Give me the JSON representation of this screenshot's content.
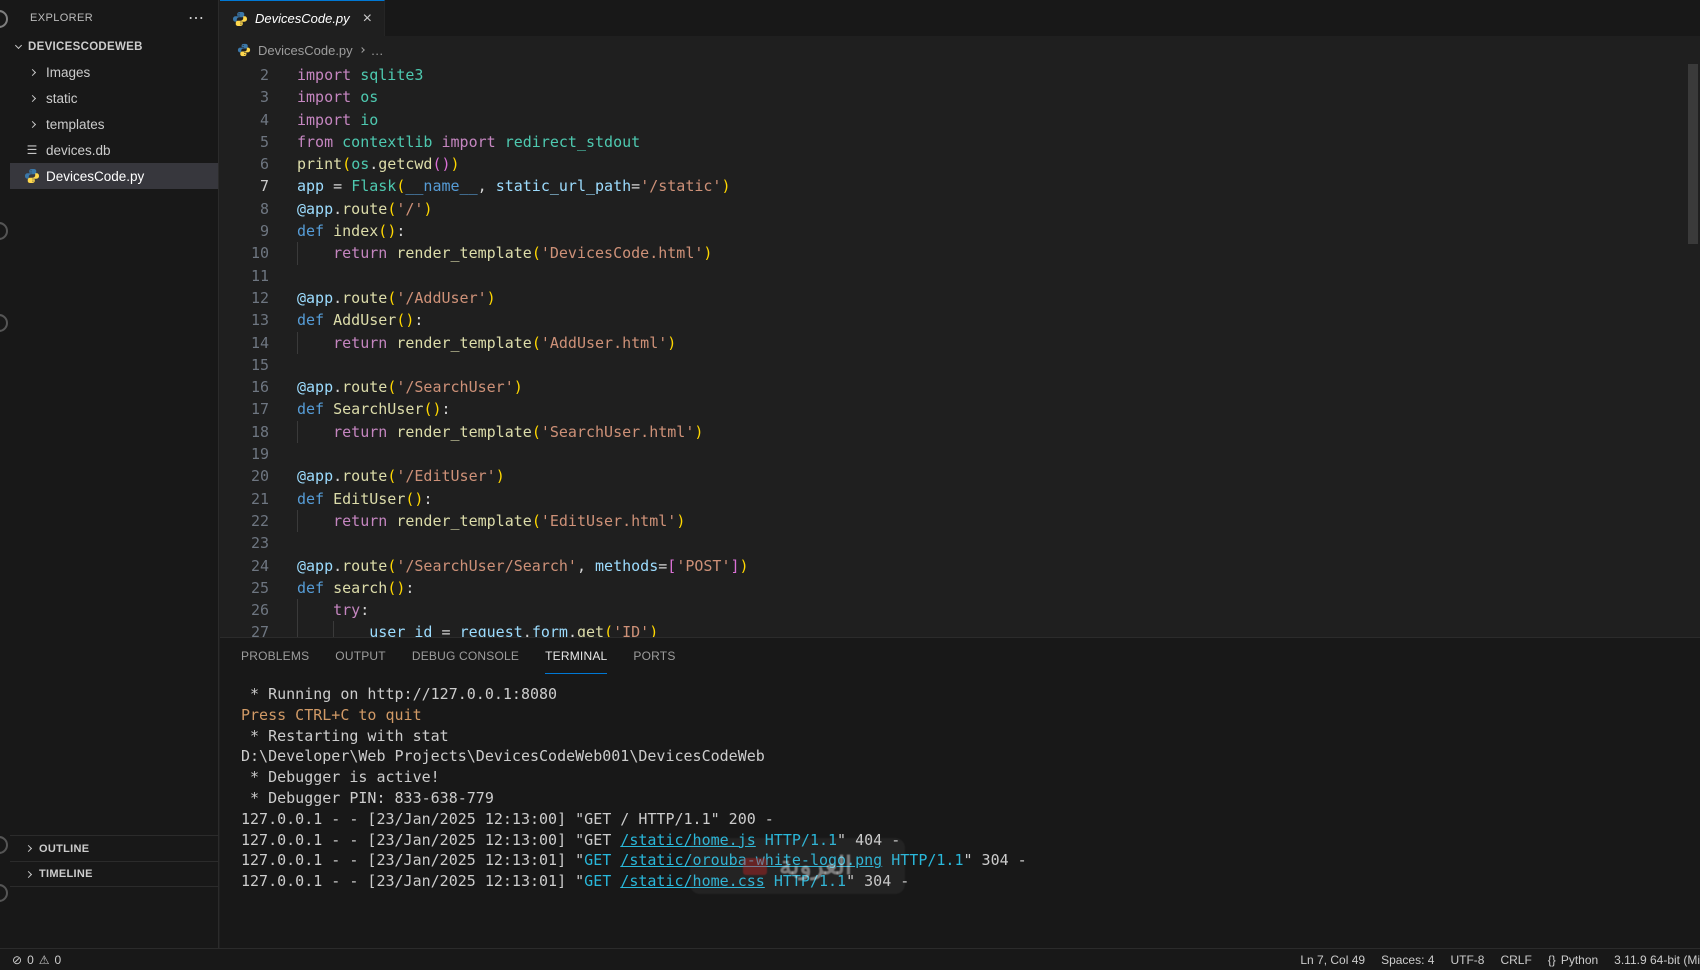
{
  "sidebar": {
    "title": "EXPLORER",
    "actions": "⋯",
    "root": "DEVICESCODEWEB",
    "items": [
      {
        "label": "Images",
        "kind": "folder"
      },
      {
        "label": "static",
        "kind": "folder"
      },
      {
        "label": "templates",
        "kind": "folder"
      },
      {
        "label": "devices.db",
        "kind": "db"
      },
      {
        "label": "DevicesCode.py",
        "kind": "python",
        "selected": true
      }
    ],
    "sections": [
      {
        "label": "OUTLINE"
      },
      {
        "label": "TIMELINE"
      }
    ]
  },
  "editor": {
    "tab": {
      "label": "DevicesCode.py",
      "close": "×"
    },
    "breadcrumb": {
      "file": "DevicesCode.py",
      "more": "…"
    },
    "code_lines": [
      {
        "num": 2,
        "tokens": [
          {
            "t": "import ",
            "c": "kw"
          },
          {
            "t": "sqlite3",
            "c": "cls"
          }
        ]
      },
      {
        "num": 3,
        "tokens": [
          {
            "t": "import ",
            "c": "kw"
          },
          {
            "t": "os",
            "c": "cls"
          }
        ]
      },
      {
        "num": 4,
        "tokens": [
          {
            "t": "import ",
            "c": "kw"
          },
          {
            "t": "io",
            "c": "cls"
          }
        ]
      },
      {
        "num": 5,
        "tokens": [
          {
            "t": "from ",
            "c": "kw"
          },
          {
            "t": "contextlib ",
            "c": "cls"
          },
          {
            "t": "import ",
            "c": "kw"
          },
          {
            "t": "redirect_stdout",
            "c": "cls"
          }
        ]
      },
      {
        "num": 6,
        "tokens": [
          {
            "t": "print",
            "c": "fn"
          },
          {
            "t": "(",
            "c": "b1"
          },
          {
            "t": "os",
            "c": "cls"
          },
          {
            "t": ".",
            "c": "pl"
          },
          {
            "t": "getcwd",
            "c": "fn"
          },
          {
            "t": "(",
            "c": "b2"
          },
          {
            "t": ")",
            "c": "b2"
          },
          {
            "t": ")",
            "c": "b1"
          }
        ]
      },
      {
        "num": 7,
        "active": true,
        "tokens": [
          {
            "t": "app ",
            "c": "var"
          },
          {
            "t": "= ",
            "c": "pl"
          },
          {
            "t": "Flask",
            "c": "cls"
          },
          {
            "t": "(",
            "c": "b1"
          },
          {
            "t": "__name__",
            "c": "def"
          },
          {
            "t": ", ",
            "c": "pl"
          },
          {
            "t": "static_url_path",
            "c": "var"
          },
          {
            "t": "=",
            "c": "pl"
          },
          {
            "t": "'/static'",
            "c": "str"
          },
          {
            "t": ")",
            "c": "b1"
          }
        ]
      },
      {
        "num": 8,
        "tokens": [
          {
            "t": "@app",
            "c": "var"
          },
          {
            "t": ".",
            "c": "pl"
          },
          {
            "t": "route",
            "c": "fn"
          },
          {
            "t": "(",
            "c": "b1"
          },
          {
            "t": "'/'",
            "c": "str"
          },
          {
            "t": ")",
            "c": "b1"
          }
        ]
      },
      {
        "num": 9,
        "tokens": [
          {
            "t": "def ",
            "c": "def"
          },
          {
            "t": "index",
            "c": "fn"
          },
          {
            "t": "(",
            "c": "b1"
          },
          {
            "t": ")",
            "c": "b1"
          },
          {
            "t": ":",
            "c": "pl"
          }
        ]
      },
      {
        "num": 10,
        "guides": 1,
        "tokens": [
          {
            "t": "    ",
            "c": "pl"
          },
          {
            "t": "return ",
            "c": "kw"
          },
          {
            "t": "render_template",
            "c": "fn"
          },
          {
            "t": "(",
            "c": "b1"
          },
          {
            "t": "'DevicesCode.html'",
            "c": "str"
          },
          {
            "t": ")",
            "c": "b1"
          }
        ]
      },
      {
        "num": 11,
        "tokens": []
      },
      {
        "num": 12,
        "tokens": [
          {
            "t": "@app",
            "c": "var"
          },
          {
            "t": ".",
            "c": "pl"
          },
          {
            "t": "route",
            "c": "fn"
          },
          {
            "t": "(",
            "c": "b1"
          },
          {
            "t": "'/AddUser'",
            "c": "str"
          },
          {
            "t": ")",
            "c": "b1"
          }
        ]
      },
      {
        "num": 13,
        "tokens": [
          {
            "t": "def ",
            "c": "def"
          },
          {
            "t": "AddUser",
            "c": "fn"
          },
          {
            "t": "(",
            "c": "b1"
          },
          {
            "t": ")",
            "c": "b1"
          },
          {
            "t": ":",
            "c": "pl"
          }
        ]
      },
      {
        "num": 14,
        "guides": 1,
        "tokens": [
          {
            "t": "    ",
            "c": "pl"
          },
          {
            "t": "return ",
            "c": "kw"
          },
          {
            "t": "render_template",
            "c": "fn"
          },
          {
            "t": "(",
            "c": "b1"
          },
          {
            "t": "'AddUser.html'",
            "c": "str"
          },
          {
            "t": ")",
            "c": "b1"
          }
        ]
      },
      {
        "num": 15,
        "tokens": []
      },
      {
        "num": 16,
        "tokens": [
          {
            "t": "@app",
            "c": "var"
          },
          {
            "t": ".",
            "c": "pl"
          },
          {
            "t": "route",
            "c": "fn"
          },
          {
            "t": "(",
            "c": "b1"
          },
          {
            "t": "'/SearchUser'",
            "c": "str"
          },
          {
            "t": ")",
            "c": "b1"
          }
        ]
      },
      {
        "num": 17,
        "tokens": [
          {
            "t": "def ",
            "c": "def"
          },
          {
            "t": "SearchUser",
            "c": "fn"
          },
          {
            "t": "(",
            "c": "b1"
          },
          {
            "t": ")",
            "c": "b1"
          },
          {
            "t": ":",
            "c": "pl"
          }
        ]
      },
      {
        "num": 18,
        "guides": 1,
        "tokens": [
          {
            "t": "    ",
            "c": "pl"
          },
          {
            "t": "return ",
            "c": "kw"
          },
          {
            "t": "render_template",
            "c": "fn"
          },
          {
            "t": "(",
            "c": "b1"
          },
          {
            "t": "'SearchUser.html'",
            "c": "str"
          },
          {
            "t": ")",
            "c": "b1"
          }
        ]
      },
      {
        "num": 19,
        "tokens": []
      },
      {
        "num": 20,
        "tokens": [
          {
            "t": "@app",
            "c": "var"
          },
          {
            "t": ".",
            "c": "pl"
          },
          {
            "t": "route",
            "c": "fn"
          },
          {
            "t": "(",
            "c": "b1"
          },
          {
            "t": "'/EditUser'",
            "c": "str"
          },
          {
            "t": ")",
            "c": "b1"
          }
        ]
      },
      {
        "num": 21,
        "tokens": [
          {
            "t": "def ",
            "c": "def"
          },
          {
            "t": "EditUser",
            "c": "fn"
          },
          {
            "t": "(",
            "c": "b1"
          },
          {
            "t": ")",
            "c": "b1"
          },
          {
            "t": ":",
            "c": "pl"
          }
        ]
      },
      {
        "num": 22,
        "guides": 1,
        "tokens": [
          {
            "t": "    ",
            "c": "pl"
          },
          {
            "t": "return ",
            "c": "kw"
          },
          {
            "t": "render_template",
            "c": "fn"
          },
          {
            "t": "(",
            "c": "b1"
          },
          {
            "t": "'EditUser.html'",
            "c": "str"
          },
          {
            "t": ")",
            "c": "b1"
          }
        ]
      },
      {
        "num": 23,
        "tokens": []
      },
      {
        "num": 24,
        "tokens": [
          {
            "t": "@app",
            "c": "var"
          },
          {
            "t": ".",
            "c": "pl"
          },
          {
            "t": "route",
            "c": "fn"
          },
          {
            "t": "(",
            "c": "b1"
          },
          {
            "t": "'/SearchUser/Search'",
            "c": "str"
          },
          {
            "t": ", ",
            "c": "pl"
          },
          {
            "t": "methods",
            "c": "var"
          },
          {
            "t": "=",
            "c": "pl"
          },
          {
            "t": "[",
            "c": "b2"
          },
          {
            "t": "'POST'",
            "c": "str"
          },
          {
            "t": "]",
            "c": "b2"
          },
          {
            "t": ")",
            "c": "b1"
          }
        ]
      },
      {
        "num": 25,
        "tokens": [
          {
            "t": "def ",
            "c": "def"
          },
          {
            "t": "search",
            "c": "fn"
          },
          {
            "t": "(",
            "c": "b1"
          },
          {
            "t": ")",
            "c": "b1"
          },
          {
            "t": ":",
            "c": "pl"
          }
        ]
      },
      {
        "num": 26,
        "guides": 1,
        "tokens": [
          {
            "t": "    ",
            "c": "pl"
          },
          {
            "t": "try",
            "c": "kw"
          },
          {
            "t": ":",
            "c": "pl"
          }
        ]
      },
      {
        "num": 27,
        "guides": 2,
        "tokens": [
          {
            "t": "        ",
            "c": "pl"
          },
          {
            "t": "user_id ",
            "c": "var"
          },
          {
            "t": "= ",
            "c": "pl"
          },
          {
            "t": "request",
            "c": "var"
          },
          {
            "t": ".",
            "c": "pl"
          },
          {
            "t": "form",
            "c": "var"
          },
          {
            "t": ".",
            "c": "pl"
          },
          {
            "t": "get",
            "c": "fn"
          },
          {
            "t": "(",
            "c": "b1"
          },
          {
            "t": "'ID'",
            "c": "str"
          },
          {
            "t": ")",
            "c": "b1"
          }
        ]
      }
    ]
  },
  "panel": {
    "tabs": [
      "PROBLEMS",
      "OUTPUT",
      "DEBUG CONSOLE",
      "TERMINAL",
      "PORTS"
    ],
    "active_tab": "TERMINAL",
    "terminal_lines": [
      [
        {
          "t": " * Running on http://127.0.0.1:8080",
          "c": "pl"
        }
      ],
      [
        {
          "t": "Press CTRL+C to quit",
          "c": "orange"
        }
      ],
      [
        {
          "t": " * Restarting with stat",
          "c": "pl"
        }
      ],
      [
        {
          "t": "D:\\Developer\\Web Projects\\DevicesCodeWeb001\\DevicesCodeWeb",
          "c": "pl"
        }
      ],
      [
        {
          "t": " * Debugger is active!",
          "c": "pl"
        }
      ],
      [
        {
          "t": " * Debugger PIN: 833-638-779",
          "c": "pl"
        }
      ],
      [
        {
          "t": "127.0.0.1 - - [23/Jan/2025 12:13:00] \"GET / HTTP/1.1\" 200 -",
          "c": "pl"
        }
      ],
      [
        {
          "t": "127.0.0.1 - - [23/Jan/2025 12:13:00] \"GET ",
          "c": "pl"
        },
        {
          "t": "/static/home.js",
          "c": "link"
        },
        {
          "t": " HTTP/1.1",
          "c": "cyan"
        },
        {
          "t": "\" 404 -",
          "c": "pl"
        }
      ],
      [
        {
          "t": "127.0.0.1 - - [23/Jan/2025 12:13:01] \"",
          "c": "pl"
        },
        {
          "t": "GET ",
          "c": "cyan"
        },
        {
          "t": "/static/orouba-white-logo.png",
          "c": "link"
        },
        {
          "t": " HTTP/1.1",
          "c": "cyan"
        },
        {
          "t": "\" 304 -",
          "c": "pl"
        }
      ],
      [
        {
          "t": "127.0.0.1 - - [23/Jan/2025 12:13:01] \"",
          "c": "pl"
        },
        {
          "t": "GET ",
          "c": "cyan"
        },
        {
          "t": "/static/home.css",
          "c": "link"
        },
        {
          "t": " HTTP/1.1",
          "c": "cyan"
        },
        {
          "t": "\" 304 -",
          "c": "pl"
        }
      ]
    ]
  },
  "status_bar": {
    "error_icon": "⊘",
    "errors": "0",
    "warning_icon": "⚠",
    "warnings": "0",
    "right": [
      {
        "label": "Ln 7, Col 49"
      },
      {
        "label": "Spaces: 4"
      },
      {
        "label": "UTF-8"
      },
      {
        "label": "CRLF"
      },
      {
        "icon": "{}",
        "label": "Python"
      },
      {
        "label": "3.11.9 64-bit (Mi"
      }
    ]
  },
  "watermark": {
    "text": "العروبة"
  },
  "colors": {
    "accent_blue": "#0078d4",
    "terminal_cyan": "#29b8db",
    "string_orange": "#ce9178",
    "python_icon_blue": "#3b77a8",
    "python_icon_yellow": "#ffd84d",
    "selection_gray": "#37373d"
  }
}
